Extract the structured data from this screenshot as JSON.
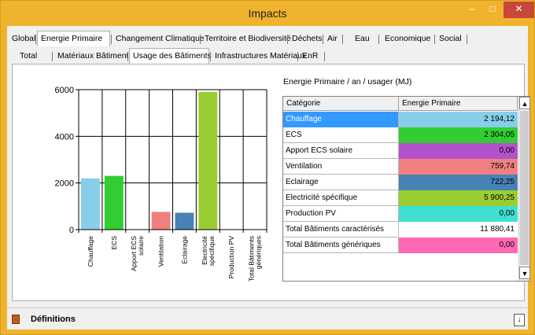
{
  "window": {
    "title": "Impacts",
    "minimize_glyph": "–",
    "maximize_glyph": "□",
    "close_glyph": "✕",
    "accent_color": "#f0b32d",
    "close_color": "#c7473b"
  },
  "tabs_main": [
    {
      "label": "Global"
    },
    {
      "label": "Energie Primaire",
      "selected": true
    },
    {
      "label": "Changement Climatique"
    },
    {
      "label": "Territoire et Biodiversité"
    },
    {
      "label": "Déchets"
    },
    {
      "label": "Air"
    },
    {
      "label": "Eau"
    },
    {
      "label": "Economique"
    },
    {
      "label": "Social"
    }
  ],
  "tabs_sub": [
    {
      "label": "Total"
    },
    {
      "label": "Matériaux Bâtiment"
    },
    {
      "label": "Usage des Bâtiments",
      "selected": true
    },
    {
      "label": "Infrastructures Matériaux"
    },
    {
      "label": "EnR"
    }
  ],
  "table": {
    "title": "Energie Primaire / an / usager (MJ)",
    "col_category": "Catégorie",
    "col_value": "Energie Primaire",
    "rows": [
      {
        "category": "Chauffage",
        "value": "2 194,12",
        "color": "#87ceeb",
        "selected": true
      },
      {
        "category": "ECS",
        "value": "2 304,05",
        "color": "#32cd32"
      },
      {
        "category": "Apport ECS solaire",
        "value": "0,00",
        "color": "#b452cd"
      },
      {
        "category": "Ventilation",
        "value": "759,74",
        "color": "#f08080"
      },
      {
        "category": "Eclairage",
        "value": "722,25",
        "color": "#4682b4"
      },
      {
        "category": "Electricité spécifique",
        "value": "5 900,25",
        "color": "#9acd32"
      },
      {
        "category": "Production PV",
        "value": "0,00",
        "color": "#40e0d0"
      },
      {
        "category": "Total Bâtiments caractérisés",
        "value": "11 880,41",
        "color": "#ffffff"
      },
      {
        "category": "Total Bâtiments génériques",
        "value": "0,00",
        "color": "#ff69b4"
      }
    ],
    "scroll_up_glyph": "▲",
    "scroll_down_glyph": "▼"
  },
  "chart_data": {
    "type": "bar",
    "categories": [
      "Chauffage",
      "ECS",
      "Apport ECS solaire",
      "Ventilation",
      "Eclairage",
      "Electricité spécifique",
      "Production PV",
      "Total Bâtiments génériques"
    ],
    "category_lines": [
      [
        "Chauffage"
      ],
      [
        "ECS"
      ],
      [
        "Apport ECS",
        "solaire"
      ],
      [
        "Ventilation"
      ],
      [
        "Eclairage"
      ],
      [
        "Electricité",
        "spécifique"
      ],
      [
        "Production PV"
      ],
      [
        "Total Bâtiments",
        "génériques"
      ]
    ],
    "values": [
      2194.12,
      2304.05,
      0,
      759.74,
      722.25,
      5900.25,
      0,
      0
    ],
    "colors": [
      "#87ceeb",
      "#32cd32",
      "#b452cd",
      "#f08080",
      "#4682b4",
      "#9acd32",
      "#40e0d0",
      "#ff69b4"
    ],
    "ylim": [
      0,
      6000
    ],
    "yticks": [
      0,
      2000,
      4000,
      6000
    ],
    "ytick_labels": [
      "0",
      "2000",
      "4000",
      "6000"
    ],
    "grid": true,
    "title": "",
    "xlabel": "",
    "ylabel": ""
  },
  "definitions": {
    "label": "Définitions",
    "expand_glyph": "↓"
  }
}
